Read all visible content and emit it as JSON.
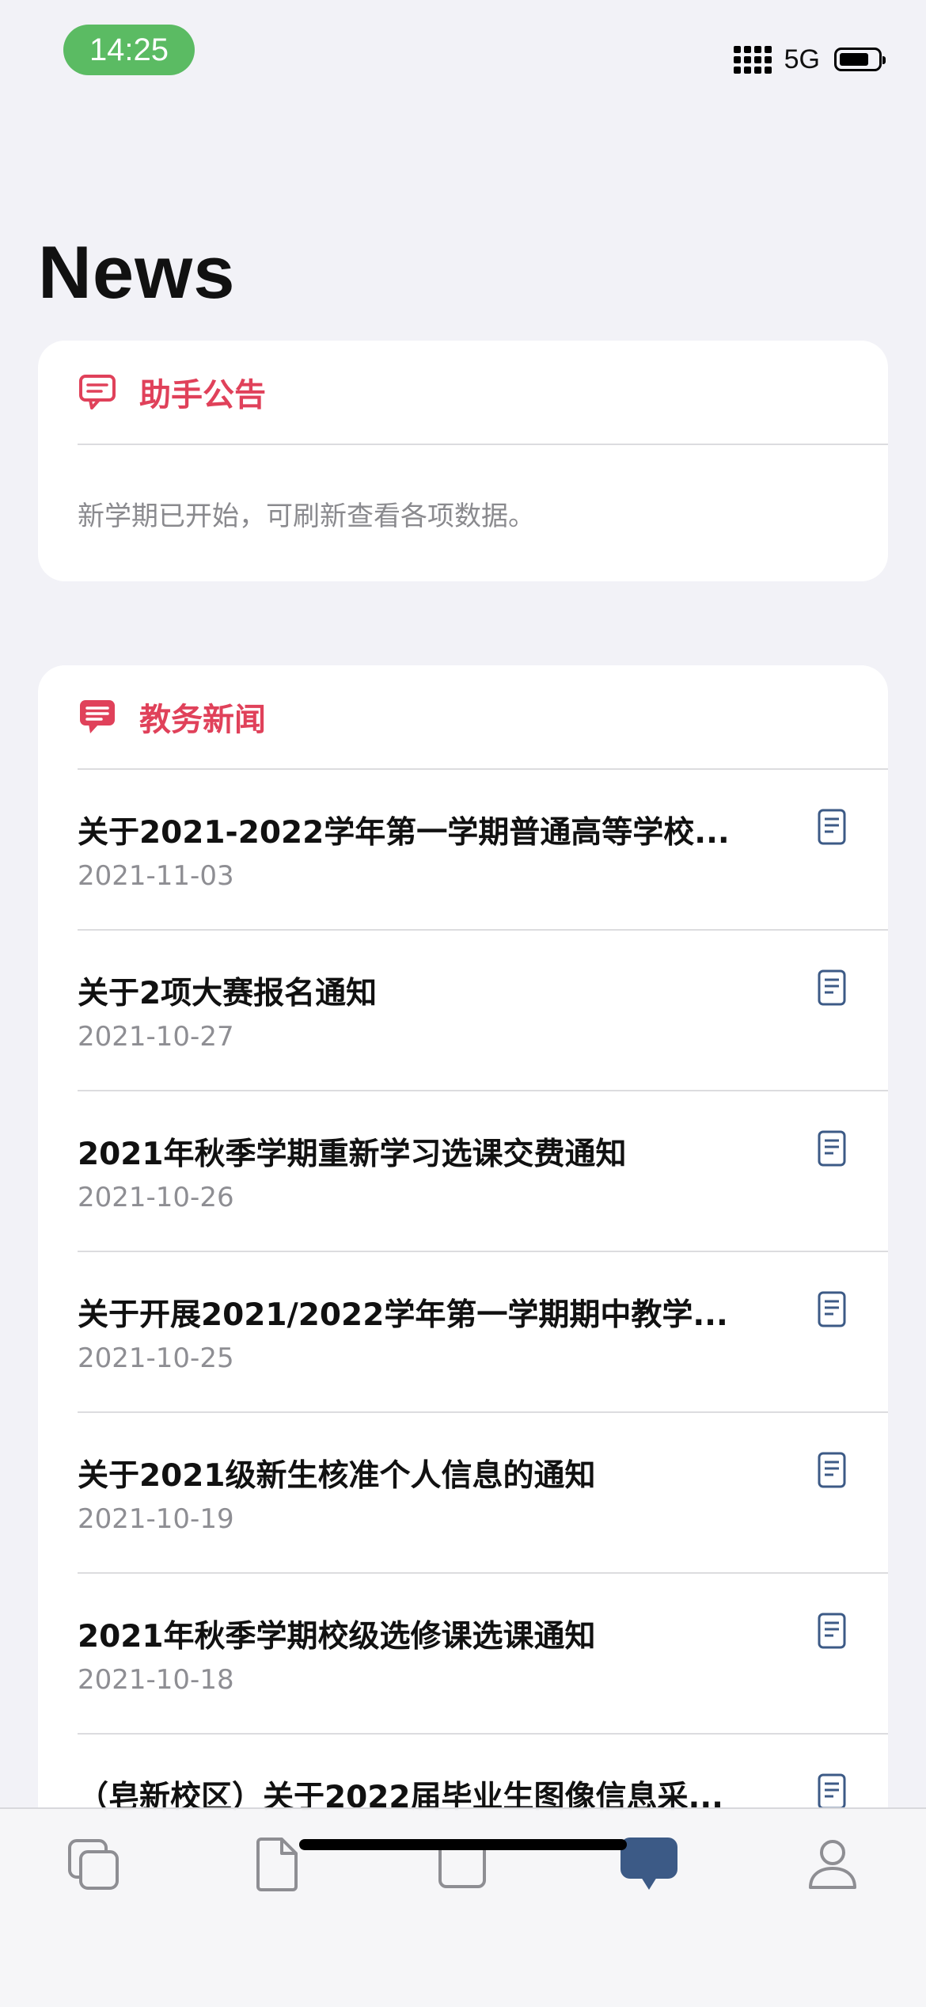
{
  "status_bar": {
    "time": "14:25",
    "network": "5G"
  },
  "page": {
    "title": "News"
  },
  "announcement": {
    "title": "助手公告",
    "text": "新学期已开始，可刷新查看各项数据。"
  },
  "news": {
    "title": "教务新闻",
    "items": [
      {
        "title": "关于2021-2022学年第一学期普通高等学校...",
        "date": "2021-11-03"
      },
      {
        "title": "关于2项大赛报名通知",
        "date": "2021-10-27"
      },
      {
        "title": "2021年秋季学期重新学习选课交费通知",
        "date": "2021-10-26"
      },
      {
        "title": "关于开展2021/2022学年第一学期期中教学...",
        "date": "2021-10-25"
      },
      {
        "title": "关于2021级新生核准个人信息的通知",
        "date": "2021-10-19"
      },
      {
        "title": "2021年秋季学期校级选修课选课通知",
        "date": "2021-10-18"
      },
      {
        "title": "（皂新校区）关于2022届毕业生图像信息采...",
        "date": ""
      }
    ]
  },
  "tabbar": {
    "tabs": [
      {
        "icon": "copy-icon",
        "active": false
      },
      {
        "icon": "document-icon",
        "active": false
      },
      {
        "icon": "square-icon",
        "active": false
      },
      {
        "icon": "chat-bubble-icon",
        "active": true
      },
      {
        "icon": "person-icon",
        "active": false
      }
    ]
  },
  "colors": {
    "accent": "#e0415a",
    "active_tab": "#3c5a86",
    "inactive_tab": "#8e8e93",
    "time_pill": "#5bbb63"
  }
}
